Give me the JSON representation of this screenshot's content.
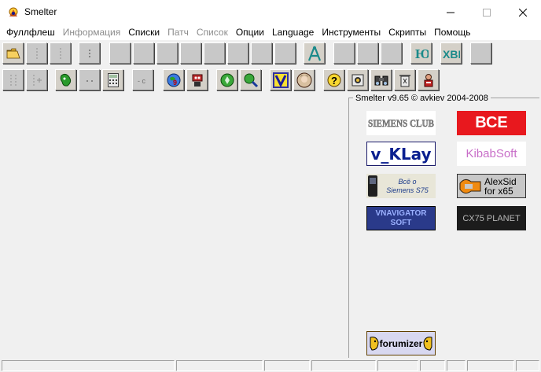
{
  "window": {
    "title": "Smelter",
    "app_icon": "hand-sun-icon",
    "controls": [
      "minimize-icon",
      "maximize-icon",
      "close-icon"
    ]
  },
  "menu": {
    "items": [
      {
        "label": "Фуллфлеш",
        "enabled": true
      },
      {
        "label": "Информация",
        "enabled": false
      },
      {
        "label": "Списки",
        "enabled": true
      },
      {
        "label": "Патч",
        "enabled": false
      },
      {
        "label": "Список",
        "enabled": false
      },
      {
        "label": "Опции",
        "enabled": true
      },
      {
        "label": "Language",
        "enabled": true
      },
      {
        "label": "Инструменты",
        "enabled": true
      },
      {
        "label": "Скрипты",
        "enabled": true
      },
      {
        "label": "Помощь",
        "enabled": true
      }
    ]
  },
  "toolbar1": {
    "buttons": [
      "open-folder-icon",
      "blank",
      "blank",
      "blank",
      "blank",
      "blank",
      "blank",
      "blank",
      "blank",
      "blank",
      "blank",
      "blank",
      "compass-icon",
      "blank",
      "blank",
      "blank",
      "ju-icon",
      "xbi-icon",
      "blank"
    ]
  },
  "toolbar2": {
    "buttons": [
      "blank",
      "blank",
      "bug-icon",
      "blank",
      "calculator-icon",
      "blank",
      "globe-icon",
      "robot-icon",
      "green-circle-icon",
      "green-search-icon",
      "v-key-icon",
      "portrait-icon",
      "help-icon",
      "chip-icon",
      "binoculars-icon",
      "trash-icon",
      "person-icon"
    ]
  },
  "side_panel": {
    "caption": "Smelter v9.65  © avkiev  2004-2008",
    "links": [
      {
        "label": "SIEMENS CLUB",
        "colors": {
          "bg": "#ffffff",
          "fg": "#8a8a8a"
        }
      },
      {
        "label": "ВСЕ",
        "colors": {
          "bg": "#e8181e",
          "fg": "#ffffff"
        }
      },
      {
        "label": "v_KLay",
        "colors": {
          "bg": "#ffffff",
          "fg": "#0a1f8f"
        }
      },
      {
        "label": "KibabSoft",
        "colors": {
          "bg": "#ffffff",
          "fg": "#c86ec8"
        }
      },
      {
        "label": "Всё о Siemens S75",
        "colors": {
          "bg": "#e8e6d8",
          "fg": "#1a3a8a"
        }
      },
      {
        "label": "AlexSid for x65",
        "colors": {
          "bg": "#c8c8c8",
          "fg": "#000000"
        }
      },
      {
        "label": "VNAVIGATOR SOFT",
        "colors": {
          "bg": "#2a3a8a",
          "fg": "#9ab0ff"
        }
      },
      {
        "label": "CX75 PLANET",
        "colors": {
          "bg": "#1c1c1c",
          "fg": "#b8b8b8"
        }
      },
      {
        "label": "forumizer",
        "colors": {
          "bg": "#d8d8f0",
          "fg": "#000000"
        }
      }
    ]
  }
}
